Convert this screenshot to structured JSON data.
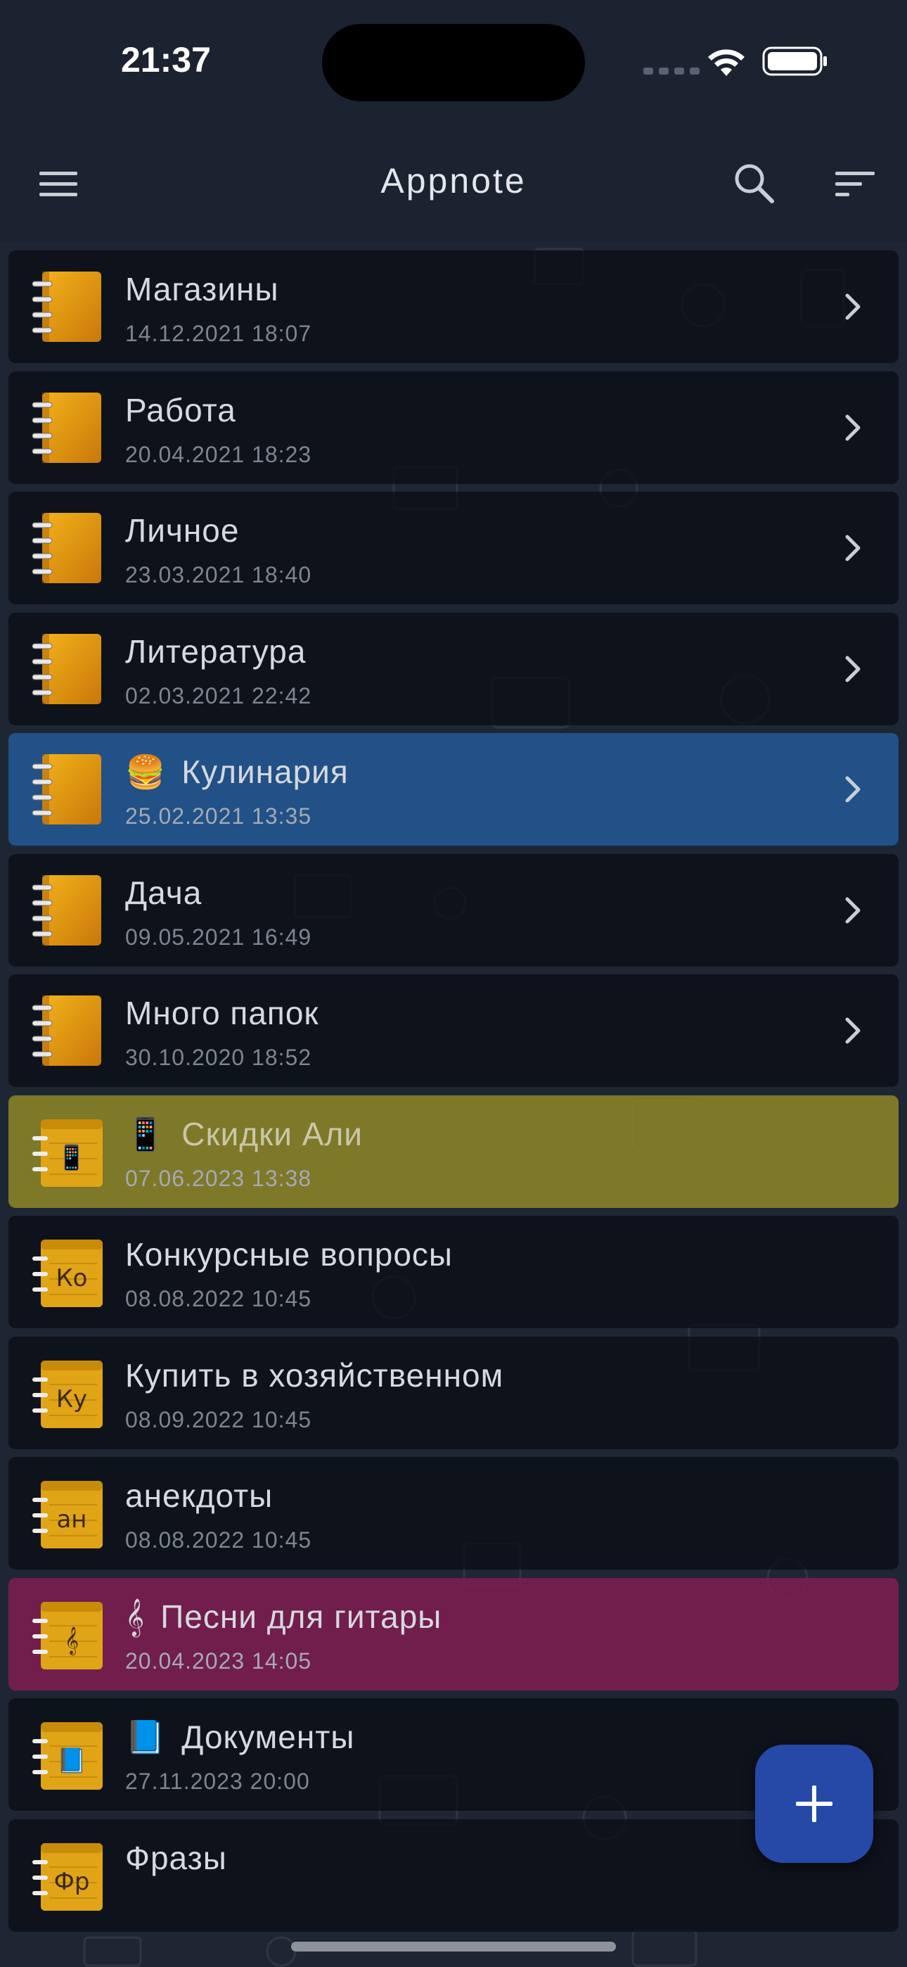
{
  "status": {
    "time": "21:37"
  },
  "app_bar": {
    "title": "Appnote"
  },
  "notebooks": [
    {
      "title": "Магазины",
      "date": "14.12.2021 18:07",
      "kind": "folder",
      "highlight": "none"
    },
    {
      "title": "Работа",
      "date": "20.04.2021 18:23",
      "kind": "folder",
      "highlight": "none"
    },
    {
      "title": "Личное",
      "date": "23.03.2021 18:40",
      "kind": "folder",
      "highlight": "none"
    },
    {
      "title": "Литература",
      "date": "02.03.2021 22:42",
      "kind": "folder",
      "highlight": "none"
    },
    {
      "title": "Кулинария",
      "emoji": "🍔",
      "date": "25.02.2021 13:35",
      "kind": "folder",
      "highlight": "#225c98"
    },
    {
      "title": "Дача",
      "date": "09.05.2021 16:49",
      "kind": "folder",
      "highlight": "none"
    },
    {
      "title": "Много папок",
      "date": "30.10.2020 18:52",
      "kind": "folder",
      "highlight": "none"
    },
    {
      "title": "Скидки Али",
      "emoji": "📱",
      "date": "07.06.2023 13:38",
      "kind": "note",
      "note_icon": "📱",
      "highlight": "#8c8428"
    },
    {
      "title": "Конкурсные вопросы",
      "date": "08.08.2022 10:45",
      "kind": "note",
      "note_icon": "Ко",
      "highlight": "none"
    },
    {
      "title": "Купить в хозяйственном",
      "date": "08.09.2022 10:45",
      "kind": "note",
      "note_icon": "Ку",
      "highlight": "none"
    },
    {
      "title": "анекдоты",
      "date": "08.08.2022 10:45",
      "kind": "note",
      "note_icon": "ан",
      "highlight": "none"
    },
    {
      "title": "Песни для гитары",
      "emoji": "𝄞",
      "date": "20.04.2023 14:05",
      "kind": "note",
      "note_icon": "𝄞",
      "highlight": "#7d1e50"
    },
    {
      "title": "Документы",
      "emoji": "📘",
      "date": "27.11.2023 20:00",
      "kind": "note",
      "note_icon": "📘",
      "highlight": "none"
    },
    {
      "title": "Фразы",
      "date": "",
      "kind": "note",
      "note_icon": "Фр",
      "highlight": "none"
    }
  ],
  "icons": {
    "menu": "hamburger-menu-icon",
    "search": "search-icon",
    "sort": "sort-icon",
    "folder": "spiral-notebook-icon",
    "note": "notepad-icon",
    "chevron": "chevron-right-icon",
    "add": "plus-icon"
  },
  "colors": {
    "background": "#1b2230",
    "accent": "#2649a8",
    "notebook": "#e49a0c"
  }
}
